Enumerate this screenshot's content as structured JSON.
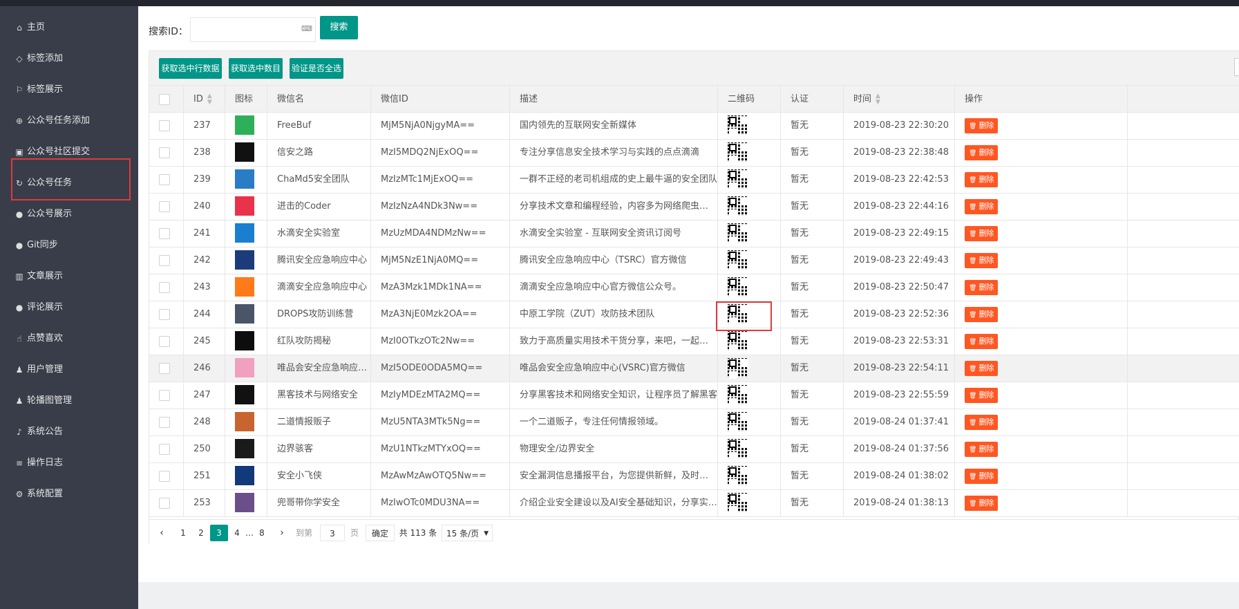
{
  "sidebar": {
    "items": [
      {
        "label": "主页",
        "icon": "home-icon"
      },
      {
        "label": "标签添加",
        "icon": "tag-icon"
      },
      {
        "label": "标签展示",
        "icon": "flag-icon"
      },
      {
        "label": "公众号任务添加",
        "icon": "plus-circle-icon"
      },
      {
        "label": "公众号社区提交",
        "icon": "edit-icon"
      },
      {
        "label": "公众号任务",
        "icon": "refresh-icon"
      },
      {
        "label": "公众号展示",
        "icon": "wechat-icon"
      },
      {
        "label": "Git同步",
        "icon": "github-icon"
      },
      {
        "label": "文章展示",
        "icon": "book-icon"
      },
      {
        "label": "评论展示",
        "icon": "comment-icon"
      },
      {
        "label": "点赞喜欢",
        "icon": "thumbs-up-icon"
      },
      {
        "label": "用户管理",
        "icon": "users-icon"
      },
      {
        "label": "轮播图管理",
        "icon": "users-icon"
      },
      {
        "label": "系统公告",
        "icon": "bell-icon"
      },
      {
        "label": "操作日志",
        "icon": "database-icon"
      },
      {
        "label": "系统配置",
        "icon": "gear-icon"
      }
    ],
    "active_index": 5
  },
  "search": {
    "label": "搜索ID：",
    "value": "",
    "placeholder": "",
    "button": "搜索"
  },
  "toolbar": {
    "get_selected_rows": "获取选中行数据",
    "get_selected_count": "获取选中数目",
    "check_all_selected": "验证是否全选"
  },
  "table": {
    "columns": [
      "ID",
      "图标",
      "微信名",
      "微信ID",
      "描述",
      "二维码",
      "认证",
      "时间",
      "操作"
    ],
    "rows": [
      {
        "id": "237",
        "name": "FreeBuf",
        "wxid": "MjM5NjA0NjgyMA==",
        "desc": "国内领先的互联网安全新媒体",
        "auth": "暂无",
        "time": "2019-08-23 22:30:20",
        "avatar_color": "#2eb05a"
      },
      {
        "id": "238",
        "name": "信安之路",
        "wxid": "MzI5MDQ2NjExOQ==",
        "desc": "专注分享信息安全技术学习与实践的点点滴滴",
        "auth": "暂无",
        "time": "2019-08-23 22:38:48",
        "avatar_color": "#111111"
      },
      {
        "id": "239",
        "name": "ChaMd5安全团队",
        "wxid": "MzIzMTc1MjExOQ==",
        "desc": "一群不正经的老司机组成的史上最牛逼的安全团队",
        "auth": "暂无",
        "time": "2019-08-23 22:42:53",
        "avatar_color": "#2a7cc7"
      },
      {
        "id": "240",
        "name": "进击的Coder",
        "wxid": "MzIzNzA4NDk3Nw==",
        "desc": "分享技术文章和编程经验，内容多为网络爬虫、机器学习",
        "auth": "暂无",
        "time": "2019-08-23 22:44:16",
        "avatar_color": "#e8334a"
      },
      {
        "id": "241",
        "name": "水滴安全实验室",
        "wxid": "MzUzMDA4NDMzNw==",
        "desc": "水滴安全实验室 - 互联网安全资讯订阅号",
        "auth": "暂无",
        "time": "2019-08-23 22:49:15",
        "avatar_color": "#1a7fd0"
      },
      {
        "id": "242",
        "name": "腾讯安全应急响应中心",
        "wxid": "MjM5NzE1NjA0MQ==",
        "desc": "腾讯安全应急响应中心（TSRC）官方微信",
        "auth": "暂无",
        "time": "2019-08-23 22:49:43",
        "avatar_color": "#1c3b7a"
      },
      {
        "id": "243",
        "name": "滴滴安全应急响应中心",
        "wxid": "MzA3Mzk1MDk1NA==",
        "desc": "滴滴安全应急响应中心官方微信公众号。",
        "auth": "暂无",
        "time": "2019-08-23 22:50:47",
        "avatar_color": "#ff7a1a"
      },
      {
        "id": "244",
        "name": "DROPS攻防训练营",
        "wxid": "MzA3NjE0Mzk2OA==",
        "desc": "中原工学院（ZUT）攻防技术团队",
        "auth": "暂无",
        "time": "2019-08-23 22:52:36",
        "avatar_color": "#4a5568"
      },
      {
        "id": "245",
        "name": "红队攻防揭秘",
        "wxid": "MzI0OTkzOTc2Nw==",
        "desc": "致力于高质量实用技术干货分享，来吧，一起来学习吧",
        "auth": "暂无",
        "time": "2019-08-23 22:53:31",
        "avatar_color": "#0d0d0d"
      },
      {
        "id": "246",
        "name": "唯品会安全应急响应中心",
        "wxid": "MzI5ODE0ODA5MQ==",
        "desc": "唯品会安全应急响应中心(VSRC)官方微信",
        "auth": "暂无",
        "time": "2019-08-23 22:54:11",
        "avatar_color": "#f2a0c0"
      },
      {
        "id": "247",
        "name": "黑客技术与网络安全",
        "wxid": "MzIyMDEzMTA2MQ==",
        "desc": "分享黑客技术和网络安全知识，让程序员了解黑客",
        "auth": "暂无",
        "time": "2019-08-23 22:55:59",
        "avatar_color": "#111111"
      },
      {
        "id": "248",
        "name": "二道情报贩子",
        "wxid": "MzU5NTA3MTk5Ng==",
        "desc": "一个二道贩子，专注任何情报领域。",
        "auth": "暂无",
        "time": "2019-08-24 01:37:41",
        "avatar_color": "#c8652f"
      },
      {
        "id": "250",
        "name": "边界骇客",
        "wxid": "MzU1NTkzMTYxOQ==",
        "desc": "物理安全/边界安全",
        "auth": "暂无",
        "time": "2019-08-24 01:37:56",
        "avatar_color": "#1a1a1a"
      },
      {
        "id": "251",
        "name": "安全小飞侠",
        "wxid": "MzAwMzAwOTQ5Nw==",
        "desc": "安全漏洞信息播报平台，为您提供新鲜，及时的漏洞情报",
        "auth": "暂无",
        "time": "2019-08-24 01:38:02",
        "avatar_color": "#123a7a"
      },
      {
        "id": "253",
        "name": "兜哥带你学安全",
        "wxid": "MzIwOTc0MDU3NA==",
        "desc": "介绍企业安全建设以及AI安全基础知识，分享实用技术",
        "auth": "暂无",
        "time": "2019-08-24 01:38:13",
        "avatar_color": "#6b4f8a"
      }
    ],
    "delete_label": "删除",
    "hover_row_index": 9
  },
  "pagination": {
    "pages": [
      "1",
      "2",
      "3",
      "4",
      "…",
      "8"
    ],
    "current": "3",
    "goto_label": "到第",
    "goto_value": "3",
    "page_unit": "页",
    "confirm": "确定",
    "total": "共 113 条",
    "page_size": "15 条/页"
  },
  "colors": {
    "sidebar_bg": "#393d49",
    "accent": "#009688",
    "danger": "#ff5722",
    "highlight": "#e03a3a"
  }
}
